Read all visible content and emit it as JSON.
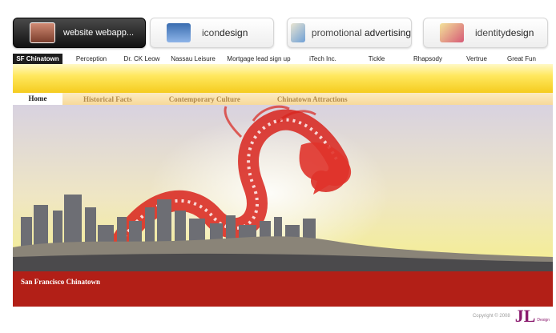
{
  "tiles": [
    {
      "label_a": "website",
      "label_b": " webapp...",
      "name": "tile-website-webapp"
    },
    {
      "label_a": "icon",
      "label_b": "design",
      "name": "tile-icondesign"
    },
    {
      "label_a": "promotional ",
      "label_b": "advertising",
      "name": "tile-promotional-advertising"
    },
    {
      "label_a": "identity",
      "label_b": "design",
      "name": "tile-identitydesign"
    }
  ],
  "nav": [
    "SF Chinatown",
    "Perception",
    "Dr. CK Leow",
    "Nassau Leisure",
    "Mortgage lead sign up",
    "iTech Inc.",
    "Tickle",
    "Rhapsody",
    "Vertrue",
    "Great Fun"
  ],
  "tabs": [
    "Home",
    "Historical Facts",
    "Contemporary Culture",
    "Chinatown Attractions"
  ],
  "hero": {
    "caption": "San Francisco Chinatown"
  },
  "footer": {
    "copyright": "Copyright © 2008",
    "logo_mark": "JL",
    "logo_text": "Design"
  },
  "colors": {
    "accent_red": "#b21f17",
    "band_yellow": "#f5cc1f",
    "tab_gold": "#b28a4c"
  }
}
